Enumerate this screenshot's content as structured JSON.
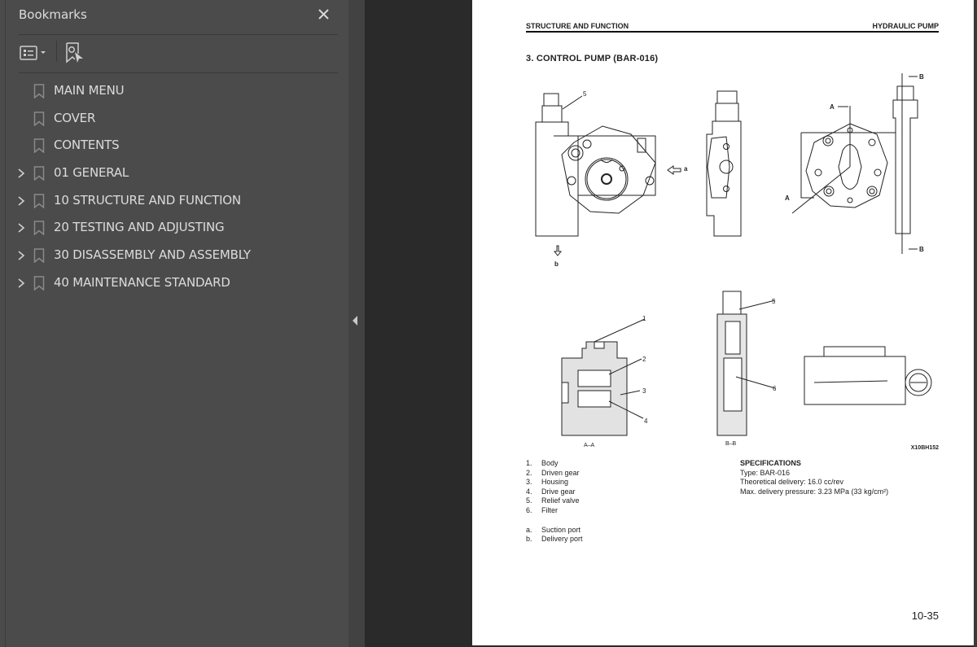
{
  "bookmarks_panel": {
    "title": "Bookmarks",
    "close_icon": "close-icon",
    "toolbar": {
      "options_icon": "list-options-icon",
      "options_dropdown_icon": "caret-down-icon",
      "find_bookmark_icon": "find-current-bookmark-icon"
    },
    "items": [
      {
        "label": "MAIN MENU",
        "expandable": false
      },
      {
        "label": "COVER",
        "expandable": false
      },
      {
        "label": "CONTENTS",
        "expandable": false
      },
      {
        "label": "01 GENERAL",
        "expandable": true
      },
      {
        "label": "10 STRUCTURE AND FUNCTION",
        "expandable": true
      },
      {
        "label": "20 TESTING AND ADJUSTING",
        "expandable": true
      },
      {
        "label": "30 DISASSEMBLY AND ASSEMBLY",
        "expandable": true
      },
      {
        "label": "40 MAINTENANCE STANDARD",
        "expandable": true
      }
    ],
    "collapse_icon": "collapse-panel-arrow-icon"
  },
  "document": {
    "header_left": "STRUCTURE AND FUNCTION",
    "header_right": "HYDRAULIC PUMP",
    "section_title": "3.  CONTROL PUMP (BAR-016)",
    "figure": {
      "callouts": {
        "c1": "1",
        "c2": "2",
        "c3": "3",
        "c4": "4",
        "c5a": "5",
        "c5b": "5",
        "c6": "6",
        "a": "a",
        "b": "b",
        "A1": "A",
        "A2": "A",
        "B1": "B",
        "B2": "B"
      },
      "captions": {
        "aa": "A–A",
        "bb": "B–B"
      },
      "figure_id": "X10BH152"
    },
    "parts": [
      {
        "n": "1.",
        "label": "Body"
      },
      {
        "n": "2.",
        "label": "Driven gear"
      },
      {
        "n": "3.",
        "label": "Housing"
      },
      {
        "n": "4.",
        "label": "Drive gear"
      },
      {
        "n": "5.",
        "label": "Relief valve"
      },
      {
        "n": "6.",
        "label": "Filter"
      }
    ],
    "ports": [
      {
        "n": "a.",
        "label": "Suction port"
      },
      {
        "n": "b.",
        "label": "Delivery port"
      }
    ],
    "specifications": {
      "heading": "SPECIFICATIONS",
      "type": "Type:  BAR-016",
      "delivery": "Theoretical delivery:  16.0 cc/rev",
      "pressure": "Max. delivery pressure:  3.23 MPa (33 kg/cm²)"
    },
    "page_number": "10-35"
  }
}
